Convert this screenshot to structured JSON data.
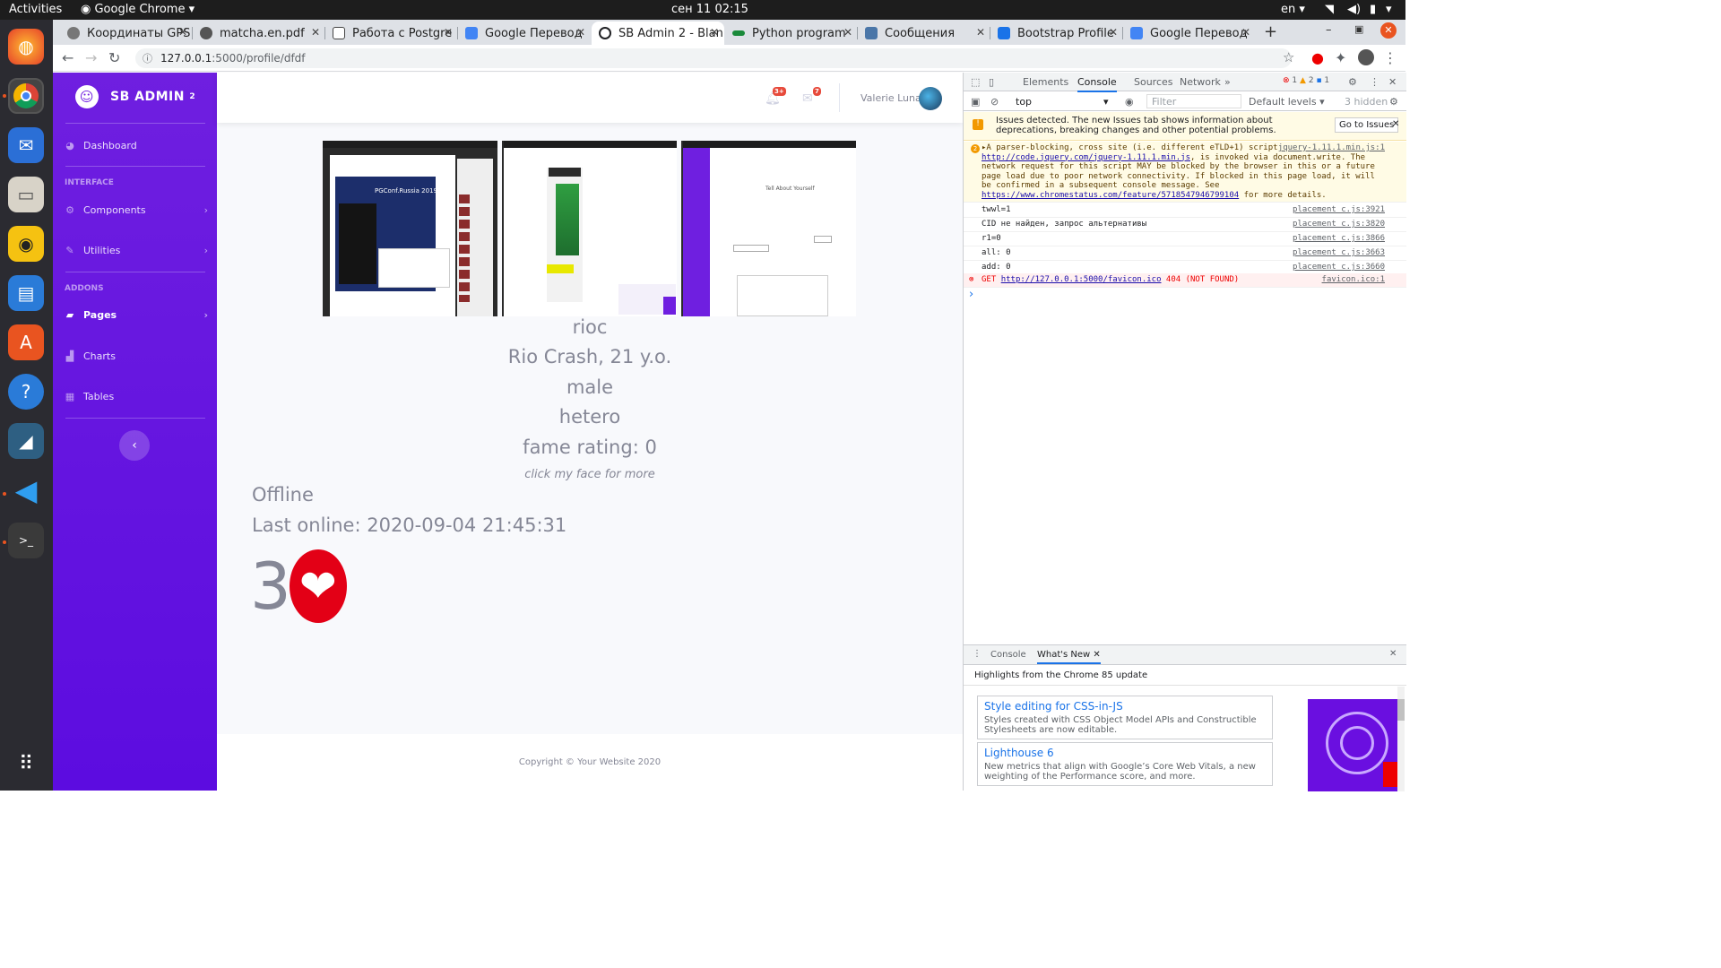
{
  "system": {
    "activities": "Activities",
    "app_name": "Google Chrome",
    "datetime": "сен 11  02:15",
    "lang": "en"
  },
  "tabs": [
    {
      "label": "Координаты GPS",
      "color": "#5f6368"
    },
    {
      "label": "matcha.en.pdf",
      "color": "#333333"
    },
    {
      "label": "Работа с Postgre",
      "color": "#444444"
    },
    {
      "label": "Google Перевод",
      "color": "#4285f4"
    },
    {
      "label": "SB Admin 2 - Blan",
      "color": "#202124"
    },
    {
      "label": "Python program",
      "color": "#1a8a3a"
    },
    {
      "label": "Сообщения",
      "color": "#4a76a8"
    },
    {
      "label": "Bootstrap Profile",
      "color": "#1a73e8"
    },
    {
      "label": "Google Перевод",
      "color": "#4285f4"
    }
  ],
  "address": {
    "host": "127.0.0.1",
    "path": ":5000/profile/dfdf"
  },
  "sidebar": {
    "brand": "SB ADMIN",
    "brand_sup": "2",
    "dashboard": "Dashboard",
    "heading_interface": "INTERFACE",
    "components": "Components",
    "utilities": "Utilities",
    "heading_addons": "ADDONS",
    "pages": "Pages",
    "charts": "Charts",
    "tables": "Tables"
  },
  "navbar": {
    "alerts_badge": "3+",
    "messages_badge": "7",
    "user_name": "Valerie Luna"
  },
  "profile": {
    "username": "rioc",
    "name_age": "Rio Crash, 21 y.o.",
    "gender": "male",
    "orientation": "hetero",
    "fame": "fame rating: 0",
    "hint": "click my face for more",
    "status": "Offline",
    "last_online": "Last online: 2020-09-04 21:45:31",
    "likes": "3"
  },
  "thumbnails": {
    "shot1_banner": "PGConf.Russia 2019",
    "shot3_title": "Tell About Yourself"
  },
  "footer": "Copyright © Your Website 2020",
  "devtools": {
    "tabs": [
      "Elements",
      "Console",
      "Sources",
      "Network"
    ],
    "errors": "1",
    "warnings": "2",
    "infos": "1",
    "context": "top",
    "filter_placeholder": "Filter",
    "levels": "Default levels",
    "hidden": "3 hidden",
    "issues_text": "Issues detected. The new Issues tab shows information about deprecations, breaking changes and other potential problems.",
    "go_to_issues": "Go to Issues",
    "warn_count": "2",
    "warn_pre": "▸A parser-blocking, cross site (i.e. different eTLD+1) script, ",
    "warn_link1": "http://code.jquery.com/jquery-1.11.1.min.js",
    "warn_mid": ", is invoked via document.write. The network request for this script MAY be blocked by the browser in this or a future page load due to poor network connectivity. If blocked in this page load, it will be confirmed in a subsequent console message. See ",
    "warn_link2": "https://www.chromestatus.com/feature/5718547946799104",
    "warn_post": " for more details.",
    "warn_src": "jquery-1.11.1.min.js:1",
    "logs": [
      {
        "text": "twwl=1",
        "src": "placement_c.js:3921"
      },
      {
        "text": "CID не найден, запрос альтернативы",
        "src": "placement_c.js:3820"
      },
      {
        "text": "r1=0",
        "src": "placement_c.js:3866"
      },
      {
        "text": "all: 0",
        "src": "placement_c.js:3663"
      },
      {
        "text": "add: 0",
        "src": "placement_c.js:3660"
      }
    ],
    "err_method": "GET",
    "err_url": "http://127.0.0.1:5000/favicon.ico",
    "err_status": "404 (NOT FOUND)",
    "err_src": "favicon.ico:1",
    "prompt": "›",
    "drawer_tabs": [
      "Console",
      "What's New"
    ],
    "highlights": "Highlights from the Chrome 85 update",
    "cards": [
      {
        "title": "Style editing for CSS-in-JS",
        "desc": "Styles created with CSS Object Model APIs and Constructible Stylesheets are now editable."
      },
      {
        "title": "Lighthouse 6",
        "desc": "New metrics that align with Google’s Core Web Vitals, a new weighting of the Performance score, and more."
      }
    ]
  }
}
